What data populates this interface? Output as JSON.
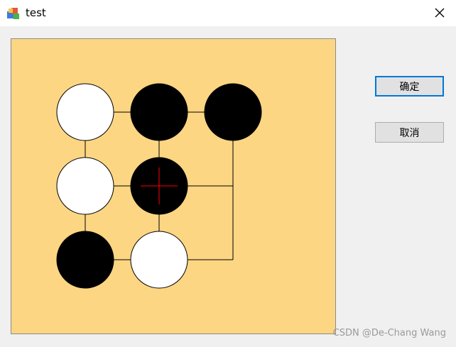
{
  "window": {
    "title": "test",
    "app_icon": "app-icon",
    "close_icon": "close-icon"
  },
  "buttons": {
    "ok_label": "确定",
    "cancel_label": "取消"
  },
  "board": {
    "background_color": "#fcd682",
    "stones": [
      {
        "row": 0,
        "col": 0,
        "color": "white"
      },
      {
        "row": 0,
        "col": 1,
        "color": "black"
      },
      {
        "row": 0,
        "col": 2,
        "color": "black"
      },
      {
        "row": 1,
        "col": 0,
        "color": "white"
      },
      {
        "row": 1,
        "col": 1,
        "color": "black",
        "marked": true
      },
      {
        "row": 2,
        "col": 0,
        "color": "black"
      },
      {
        "row": 2,
        "col": 1,
        "color": "white"
      }
    ],
    "marker_color": "#ff0000"
  },
  "watermark": "CSDN @De-Chang Wang",
  "accent_color": "#0078d7"
}
